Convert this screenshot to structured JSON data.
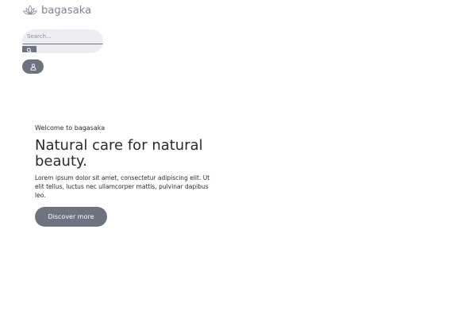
{
  "header": {
    "logo_text": "bagasaka",
    "logo_icon": "lotus-icon"
  },
  "search": {
    "placeholder": "Search...",
    "value": "",
    "button_icon": "search-icon"
  },
  "user": {
    "button_icon": "user-icon"
  },
  "hero": {
    "eyebrow": "Welcome to bagasaka",
    "title": "Natural care for natural beauty.",
    "text": "Lorem ipsum dolor sit amet, consectetur adipiscing elit. Ut elit tellus, luctus nec ullamcorper mattis, pulvinar dapibus leo.",
    "button_label": "Discover more"
  },
  "colors": {
    "accent": "#6d7480",
    "logo": "#7c8591",
    "search_bg": "#eceef1",
    "text": "#2b2b2b"
  }
}
